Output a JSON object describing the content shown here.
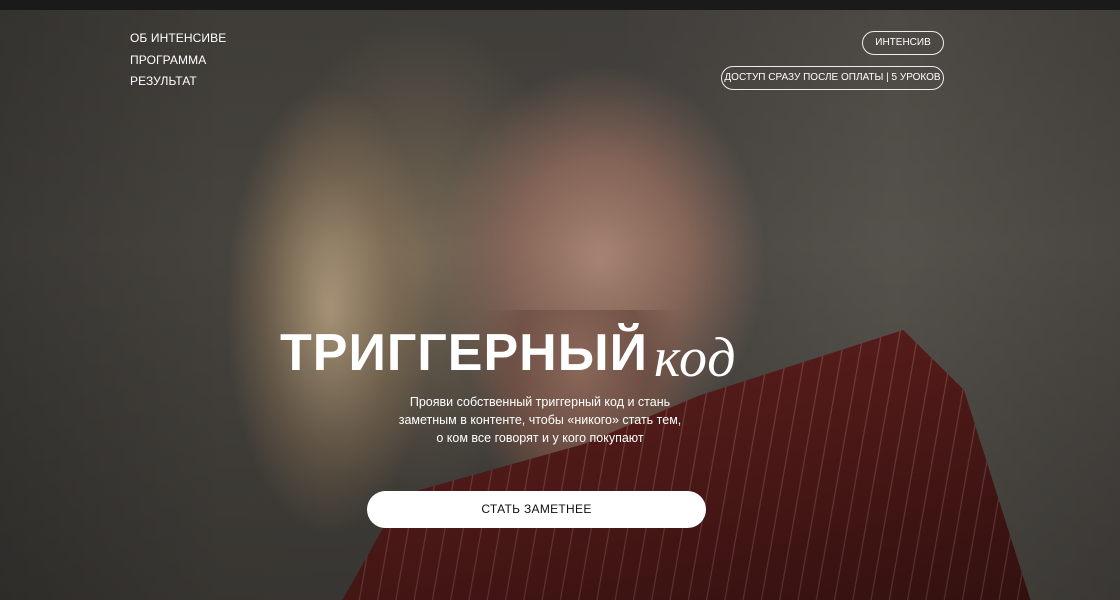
{
  "nav": {
    "items": [
      {
        "label": "ОБ ИНТЕНСИВЕ"
      },
      {
        "label": "ПРОГРАММА"
      },
      {
        "label": "РЕЗУЛЬТАТ"
      }
    ]
  },
  "badges": {
    "intensive": "ИНТЕНСИВ",
    "access": "ДОСТУП СРАЗУ ПОСЛЕ ОПЛАТЫ | 5 УРОКОВ"
  },
  "hero": {
    "title_main": "ТРИГГЕРНЫЙ",
    "title_accent": "код",
    "subtitle_line1": "Прояви собственный триггерный код и стань",
    "subtitle_line2": "заметным в контенте, чтобы «никого» стать тем,",
    "subtitle_line3": "о ком все говорят и у кого покупают",
    "cta_label": "СТАТЬ ЗАМЕТНЕЕ"
  },
  "colors": {
    "background": "#141414",
    "text": "#ffffff",
    "cta_background": "#ffffff",
    "cta_text": "#111111",
    "jacket": "#5a1d1b"
  }
}
